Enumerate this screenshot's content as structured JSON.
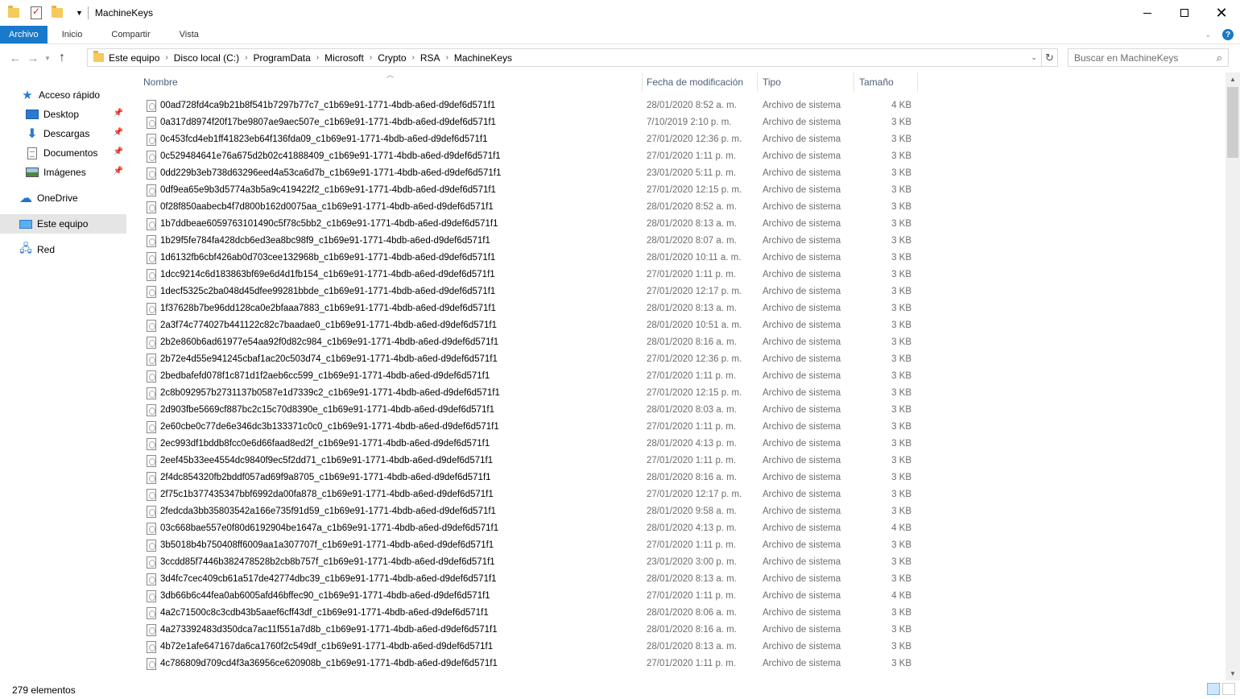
{
  "window": {
    "title": "MachineKeys",
    "minimize_glyph": "—",
    "close_glyph": "✕"
  },
  "ribbon": {
    "tabs": [
      "Archivo",
      "Inicio",
      "Compartir",
      "Vista"
    ],
    "help": "?"
  },
  "address": {
    "crumbs": [
      "Este equipo",
      "Disco local (C:)",
      "ProgramData",
      "Microsoft",
      "Crypto",
      "RSA",
      "MachineKeys"
    ]
  },
  "search": {
    "placeholder": "Buscar en MachineKeys"
  },
  "sidebar": {
    "items": [
      {
        "label": "Acceso rápido",
        "icon": "star-icon"
      },
      {
        "label": "Desktop",
        "icon": "desktop-icon",
        "pinned": true
      },
      {
        "label": "Descargas",
        "icon": "download-icon",
        "pinned": true
      },
      {
        "label": "Documentos",
        "icon": "document-icon",
        "pinned": true
      },
      {
        "label": "Imágenes",
        "icon": "pictures-icon",
        "pinned": true
      },
      {
        "label": "OneDrive",
        "icon": "cloud-icon"
      },
      {
        "label": "Este equipo",
        "icon": "computer-icon",
        "selected": true
      },
      {
        "label": "Red",
        "icon": "network-icon"
      }
    ]
  },
  "columns": {
    "name": "Nombre",
    "date": "Fecha de modificación",
    "type": "Tipo",
    "size": "Tamaño"
  },
  "files": [
    {
      "name": "00ad728fd4ca9b21b8f541b7297b77c7_c1b69e91-1771-4bdb-a6ed-d9def6d571f1",
      "date": "28/01/2020 8:52 a. m.",
      "type": "Archivo de sistema",
      "size": "4 KB"
    },
    {
      "name": "0a317d8974f20f17be9807ae9aec507e_c1b69e91-1771-4bdb-a6ed-d9def6d571f1",
      "date": "7/10/2019 2:10 p. m.",
      "type": "Archivo de sistema",
      "size": "3 KB"
    },
    {
      "name": "0c453fcd4eb1ff41823eb64f136fda09_c1b69e91-1771-4bdb-a6ed-d9def6d571f1",
      "date": "27/01/2020 12:36 p. m.",
      "type": "Archivo de sistema",
      "size": "3 KB"
    },
    {
      "name": "0c529484641e76a675d2b02c41888409_c1b69e91-1771-4bdb-a6ed-d9def6d571f1",
      "date": "27/01/2020 1:11 p. m.",
      "type": "Archivo de sistema",
      "size": "3 KB"
    },
    {
      "name": "0dd229b3eb738d63296eed4a53ca6d7b_c1b69e91-1771-4bdb-a6ed-d9def6d571f1",
      "date": "23/01/2020 5:11 p. m.",
      "type": "Archivo de sistema",
      "size": "3 KB"
    },
    {
      "name": "0df9ea65e9b3d5774a3b5a9c419422f2_c1b69e91-1771-4bdb-a6ed-d9def6d571f1",
      "date": "27/01/2020 12:15 p. m.",
      "type": "Archivo de sistema",
      "size": "3 KB"
    },
    {
      "name": "0f28f850aabecb4f7d800b162d0075aa_c1b69e91-1771-4bdb-a6ed-d9def6d571f1",
      "date": "28/01/2020 8:52 a. m.",
      "type": "Archivo de sistema",
      "size": "3 KB"
    },
    {
      "name": "1b7ddbeae6059763101490c5f78c5bb2_c1b69e91-1771-4bdb-a6ed-d9def6d571f1",
      "date": "28/01/2020 8:13 a. m.",
      "type": "Archivo de sistema",
      "size": "3 KB"
    },
    {
      "name": "1b29f5fe784fa428dcb6ed3ea8bc98f9_c1b69e91-1771-4bdb-a6ed-d9def6d571f1",
      "date": "28/01/2020 8:07 a. m.",
      "type": "Archivo de sistema",
      "size": "3 KB"
    },
    {
      "name": "1d6132fb6cbf426ab0d703cee132968b_c1b69e91-1771-4bdb-a6ed-d9def6d571f1",
      "date": "28/01/2020 10:11 a. m.",
      "type": "Archivo de sistema",
      "size": "3 KB"
    },
    {
      "name": "1dcc9214c6d183863bf69e6d4d1fb154_c1b69e91-1771-4bdb-a6ed-d9def6d571f1",
      "date": "27/01/2020 1:11 p. m.",
      "type": "Archivo de sistema",
      "size": "3 KB"
    },
    {
      "name": "1decf5325c2ba048d45dfee99281bbde_c1b69e91-1771-4bdb-a6ed-d9def6d571f1",
      "date": "27/01/2020 12:17 p. m.",
      "type": "Archivo de sistema",
      "size": "3 KB"
    },
    {
      "name": "1f37628b7be96dd128ca0e2bfaaa7883_c1b69e91-1771-4bdb-a6ed-d9def6d571f1",
      "date": "28/01/2020 8:13 a. m.",
      "type": "Archivo de sistema",
      "size": "3 KB"
    },
    {
      "name": "2a3f74c774027b441122c82c7baadae0_c1b69e91-1771-4bdb-a6ed-d9def6d571f1",
      "date": "28/01/2020 10:51 a. m.",
      "type": "Archivo de sistema",
      "size": "3 KB"
    },
    {
      "name": "2b2e860b6ad61977e54aa92f0d82c984_c1b69e91-1771-4bdb-a6ed-d9def6d571f1",
      "date": "28/01/2020 8:16 a. m.",
      "type": "Archivo de sistema",
      "size": "3 KB"
    },
    {
      "name": "2b72e4d55e941245cbaf1ac20c503d74_c1b69e91-1771-4bdb-a6ed-d9def6d571f1",
      "date": "27/01/2020 12:36 p. m.",
      "type": "Archivo de sistema",
      "size": "3 KB"
    },
    {
      "name": "2bedbafefd078f1c871d1f2aeb6cc599_c1b69e91-1771-4bdb-a6ed-d9def6d571f1",
      "date": "27/01/2020 1:11 p. m.",
      "type": "Archivo de sistema",
      "size": "3 KB"
    },
    {
      "name": "2c8b092957b2731137b0587e1d7339c2_c1b69e91-1771-4bdb-a6ed-d9def6d571f1",
      "date": "27/01/2020 12:15 p. m.",
      "type": "Archivo de sistema",
      "size": "3 KB"
    },
    {
      "name": "2d903fbe5669cf887bc2c15c70d8390e_c1b69e91-1771-4bdb-a6ed-d9def6d571f1",
      "date": "28/01/2020 8:03 a. m.",
      "type": "Archivo de sistema",
      "size": "3 KB"
    },
    {
      "name": "2e60cbe0c77de6e346dc3b133371c0c0_c1b69e91-1771-4bdb-a6ed-d9def6d571f1",
      "date": "27/01/2020 1:11 p. m.",
      "type": "Archivo de sistema",
      "size": "3 KB"
    },
    {
      "name": "2ec993df1bddb8fcc0e6d66faad8ed2f_c1b69e91-1771-4bdb-a6ed-d9def6d571f1",
      "date": "28/01/2020 4:13 p. m.",
      "type": "Archivo de sistema",
      "size": "3 KB"
    },
    {
      "name": "2eef45b33ee4554dc9840f9ec5f2dd71_c1b69e91-1771-4bdb-a6ed-d9def6d571f1",
      "date": "27/01/2020 1:11 p. m.",
      "type": "Archivo de sistema",
      "size": "3 KB"
    },
    {
      "name": "2f4dc854320fb2bddf057ad69f9a8705_c1b69e91-1771-4bdb-a6ed-d9def6d571f1",
      "date": "28/01/2020 8:16 a. m.",
      "type": "Archivo de sistema",
      "size": "3 KB"
    },
    {
      "name": "2f75c1b377435347bbf6992da00fa878_c1b69e91-1771-4bdb-a6ed-d9def6d571f1",
      "date": "27/01/2020 12:17 p. m.",
      "type": "Archivo de sistema",
      "size": "3 KB"
    },
    {
      "name": "2fedcda3bb35803542a166e735f91d59_c1b69e91-1771-4bdb-a6ed-d9def6d571f1",
      "date": "28/01/2020 9:58 a. m.",
      "type": "Archivo de sistema",
      "size": "3 KB"
    },
    {
      "name": "03c668bae557e0f80d6192904be1647a_c1b69e91-1771-4bdb-a6ed-d9def6d571f1",
      "date": "28/01/2020 4:13 p. m.",
      "type": "Archivo de sistema",
      "size": "4 KB"
    },
    {
      "name": "3b5018b4b750408ff6009aa1a307707f_c1b69e91-1771-4bdb-a6ed-d9def6d571f1",
      "date": "27/01/2020 1:11 p. m.",
      "type": "Archivo de sistema",
      "size": "3 KB"
    },
    {
      "name": "3ccdd85f7446b382478528b2cb8b757f_c1b69e91-1771-4bdb-a6ed-d9def6d571f1",
      "date": "23/01/2020 3:00 p. m.",
      "type": "Archivo de sistema",
      "size": "3 KB"
    },
    {
      "name": "3d4fc7cec409cb61a517de42774dbc39_c1b69e91-1771-4bdb-a6ed-d9def6d571f1",
      "date": "28/01/2020 8:13 a. m.",
      "type": "Archivo de sistema",
      "size": "3 KB"
    },
    {
      "name": "3db66b6c44fea0ab6005afd46bffec90_c1b69e91-1771-4bdb-a6ed-d9def6d571f1",
      "date": "27/01/2020 1:11 p. m.",
      "type": "Archivo de sistema",
      "size": "4 KB"
    },
    {
      "name": "4a2c71500c8c3cdb43b5aaef6cff43df_c1b69e91-1771-4bdb-a6ed-d9def6d571f1",
      "date": "28/01/2020 8:06 a. m.",
      "type": "Archivo de sistema",
      "size": "3 KB"
    },
    {
      "name": "4a273392483d350dca7ac11f551a7d8b_c1b69e91-1771-4bdb-a6ed-d9def6d571f1",
      "date": "28/01/2020 8:16 a. m.",
      "type": "Archivo de sistema",
      "size": "3 KB"
    },
    {
      "name": "4b72e1afe647167da6ca1760f2c549df_c1b69e91-1771-4bdb-a6ed-d9def6d571f1",
      "date": "28/01/2020 8:13 a. m.",
      "type": "Archivo de sistema",
      "size": "3 KB"
    },
    {
      "name": "4c786809d709cd4f3a36956ce620908b_c1b69e91-1771-4bdb-a6ed-d9def6d571f1",
      "date": "27/01/2020 1:11 p. m.",
      "type": "Archivo de sistema",
      "size": "3 KB"
    }
  ],
  "status": {
    "count": "279 elementos"
  }
}
